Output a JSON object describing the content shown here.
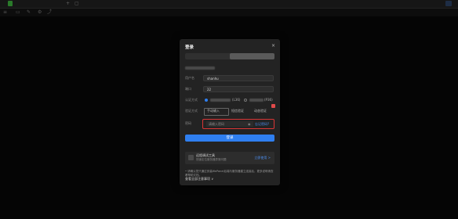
{
  "topbar": {
    "tag": "",
    "tab_title": "",
    "right_badge": ""
  },
  "dialog": {
    "title": "登录",
    "close": "×",
    "tabs": [
      "",
      ""
    ],
    "labels": {
      "user": "用户名",
      "port": "端口",
      "method": "认证方式",
      "verify": "验证方式",
      "secret": "密码"
    },
    "user_value": "shanhu",
    "port_value": "22",
    "radio_suffix_1": "(L36)",
    "radio_suffix_2": "(P36)",
    "verify_options": [
      "手动输入",
      "短信验证",
      "动态验证"
    ],
    "secret_placeholder": "请输入密码",
    "secret_link": "忘记密码?",
    "login_button": "登录",
    "tool_card": {
      "title": "远程调试工具",
      "desc": "快速定位服务器异常问题",
      "link": "立即使用 >"
    },
    "notice": "• 请确认您只通过安装WePanel后端与服务器建立连接后，更多说明请查看帮助文档。",
    "more_link": "查看全部注意事项 ∨"
  }
}
